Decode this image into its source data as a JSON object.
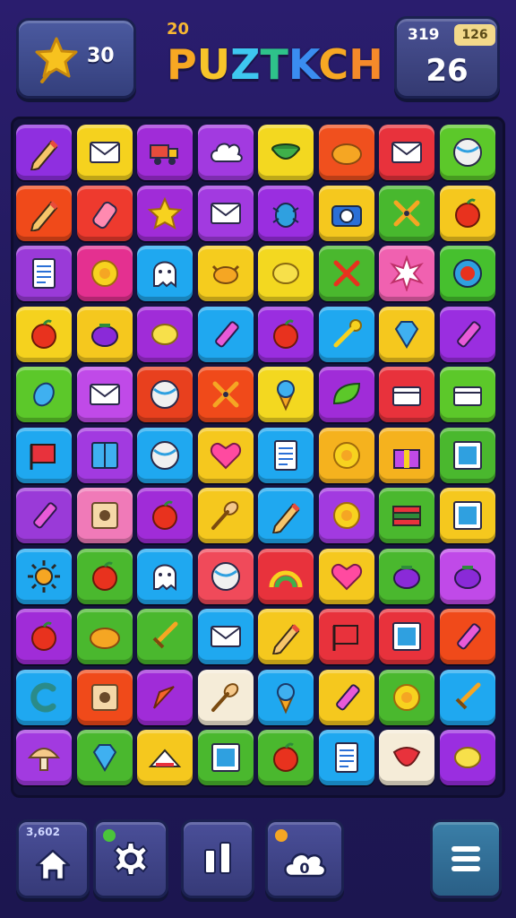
{
  "header": {
    "stars": "30",
    "title_prefix": "20",
    "title_letters": [
      "P",
      "U",
      "Z",
      "T",
      "K",
      "C",
      "H"
    ],
    "title_colors": [
      "#f7a823",
      "#f7c52a",
      "#3ec7f0",
      "#2ec28a",
      "#3a8df0",
      "#f7a823",
      "#f58a2a"
    ],
    "score_label": "319",
    "score_badge": "126",
    "score_value": "26"
  },
  "board": {
    "rows": [
      [
        [
          "#8f2fe0",
          "pencil"
        ],
        [
          "#f5d21e",
          "envelope"
        ],
        [
          "#a02cd8",
          "truck"
        ],
        [
          "#a23ae0",
          "cloud"
        ],
        [
          "#f3d820",
          "bowl"
        ],
        [
          "#f0501e",
          "bread"
        ],
        [
          "#e8323c",
          "envelope"
        ],
        [
          "#5cc82a",
          "ball"
        ]
      ],
      [
        [
          "#f04a1a",
          "pencil"
        ],
        [
          "#ee3a2e",
          "bottle"
        ],
        [
          "#a02cd8",
          "star"
        ],
        [
          "#a23ae0",
          "envelope"
        ],
        [
          "#9a2ee0",
          "bug"
        ],
        [
          "#f5c81e",
          "camera"
        ],
        [
          "#48b82e",
          "scissors"
        ],
        [
          "#f5c81e",
          "apple"
        ]
      ],
      [
        [
          "#9a3ad8",
          "note"
        ],
        [
          "#e43090",
          "flower"
        ],
        [
          "#1fa8f0",
          "ghost"
        ],
        [
          "#f5cc1e",
          "crab"
        ],
        [
          "#f3d820",
          "lemon"
        ],
        [
          "#4ab82e",
          "tools"
        ],
        [
          "#f061b0",
          "burst"
        ],
        [
          "#46c02e",
          "target"
        ]
      ],
      [
        [
          "#f5d21e",
          "apple"
        ],
        [
          "#f5c81e",
          "eggplant"
        ],
        [
          "#a02cd8",
          "lemon"
        ],
        [
          "#1fa8f0",
          "crayon"
        ],
        [
          "#9a2ee0",
          "apple"
        ],
        [
          "#1fa8f0",
          "key"
        ],
        [
          "#f5c81e",
          "gem"
        ],
        [
          "#9a2ee0",
          "crayon"
        ]
      ],
      [
        [
          "#5cc82a",
          "candy"
        ],
        [
          "#c04ae8",
          "envelope"
        ],
        [
          "#e8401e",
          "ball"
        ],
        [
          "#f04a1a",
          "scissors"
        ],
        [
          "#f3d820",
          "icecream"
        ],
        [
          "#a02cd8",
          "leaf"
        ],
        [
          "#e8323c",
          "box"
        ],
        [
          "#5cc82a",
          "box"
        ]
      ],
      [
        [
          "#1fa8f0",
          "flag"
        ],
        [
          "#a23ae0",
          "book"
        ],
        [
          "#1fa8f0",
          "ball"
        ],
        [
          "#f5c81e",
          "heart"
        ],
        [
          "#1fa8f0",
          "note"
        ],
        [
          "#f5b21e",
          "flower"
        ],
        [
          "#f5b21e",
          "gift"
        ],
        [
          "#4ab82e",
          "frame"
        ]
      ],
      [
        [
          "#9a3ad8",
          "crayon"
        ],
        [
          "#f07ab8",
          "photo"
        ],
        [
          "#a02cd8",
          "apple"
        ],
        [
          "#f5c81e",
          "spoon"
        ],
        [
          "#1fa8f0",
          "pencil"
        ],
        [
          "#a23ae0",
          "flower"
        ],
        [
          "#4ab82e",
          "books"
        ],
        [
          "#f5c81e",
          "frame"
        ]
      ],
      [
        [
          "#1fa8f0",
          "sun"
        ],
        [
          "#4ab82e",
          "apple"
        ],
        [
          "#1fa8f0",
          "ghost"
        ],
        [
          "#f04a5a",
          "ball"
        ],
        [
          "#e8323c",
          "rainbow"
        ],
        [
          "#f5c81e",
          "heart"
        ],
        [
          "#4ab82e",
          "eggplant"
        ],
        [
          "#c04ae8",
          "eggplant"
        ]
      ],
      [
        [
          "#a02cd8",
          "apple"
        ],
        [
          "#4ab82e",
          "bread"
        ],
        [
          "#4ab82e",
          "sword"
        ],
        [
          "#1fa8f0",
          "envelope"
        ],
        [
          "#f5c81e",
          "pencil"
        ],
        [
          "#e8323c",
          "flag"
        ],
        [
          "#e8323c",
          "frame"
        ],
        [
          "#f04a1a",
          "crayon"
        ]
      ],
      [
        [
          "#1fa8f0",
          "letterC"
        ],
        [
          "#f04a1a",
          "photo"
        ],
        [
          "#a02cd8",
          "carrot"
        ],
        [
          "#f5ecd8",
          "spoon"
        ],
        [
          "#1fa8f0",
          "icecream"
        ],
        [
          "#f5c81e",
          "crayon"
        ],
        [
          "#4ab82e",
          "flower"
        ],
        [
          "#1fa8f0",
          "sword"
        ]
      ],
      [
        [
          "#a23ae0",
          "mushroom"
        ],
        [
          "#4ab82e",
          "gem"
        ],
        [
          "#f5c81e",
          "cake"
        ],
        [
          "#4ab82e",
          "frame"
        ],
        [
          "#4ab82e",
          "apple"
        ],
        [
          "#1fa8f0",
          "note"
        ],
        [
          "#f5ecd8",
          "strawberry"
        ],
        [
          "#9a2ee0",
          "lemon"
        ]
      ]
    ]
  },
  "bottom_nav": {
    "home_badge": "3,602",
    "lives_value": "0"
  },
  "colors": {
    "background": "#251b63",
    "panel": "#3d4590",
    "accent": "#f7b733"
  }
}
